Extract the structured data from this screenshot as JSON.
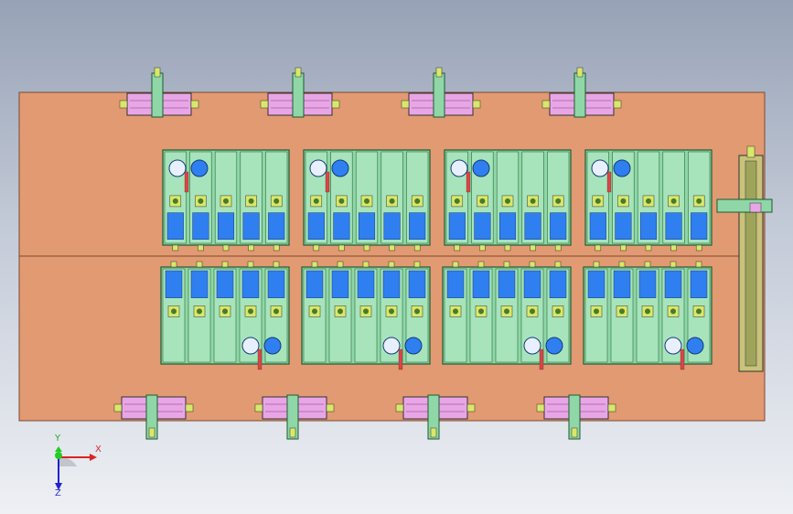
{
  "colors": {
    "plate": "#e29a72",
    "plate_edge": "#7a4a30",
    "module_green": "#8fd7a6",
    "module_dark": "#1d5a32",
    "roller_blue": "#2f7ff0",
    "slide_pink": "#e8a6e6",
    "bracket_yellow": "#d8e86a",
    "rail_tan": "#c9c27a"
  },
  "icons": {
    "triad": "xyz-orientation-triad-icon"
  },
  "axes": {
    "x_label": "X",
    "y_label": "Y",
    "z_label": "Z"
  }
}
